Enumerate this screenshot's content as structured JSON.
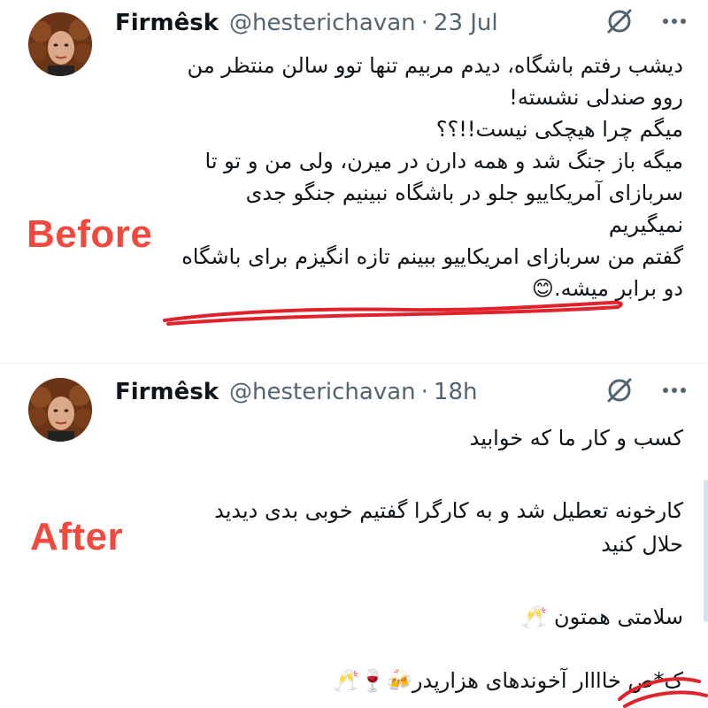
{
  "tweets": [
    {
      "name": "Firmêsk",
      "handle": "@hesterichavan",
      "separator": "·",
      "time": "23 Jul",
      "lines": [
        "دیشب رفتم باشگاه، دیدم مربیم تنها توو سالن منتظر من",
        "روو صندلی نشسته!",
        "میگم چرا هیچکی نیست!!؟؟",
        "میگه باز جنگ شد و همه دارن در میرن، ولی من و تو تا",
        "سربازای آمریکاییو جلو در باشگاه نبینیم جنگو جدی",
        "نمیگیریم",
        "گفتم من سربازای امریکاییو ببینم تازه انگیزم برای باشگاه",
        "دو برابر میشه.😊"
      ]
    },
    {
      "name": "Firmêsk",
      "handle": "@hesterichavan",
      "separator": "·",
      "time": "18h",
      "lines": [
        "کسب و کار ما که خوابید",
        "کارخونه تعطیل شد و به کارگرا گفتیم خوبی بدی دیدید",
        "حلال کنید",
        "سلامتی همتون 🥂",
        "ک*ص خاااار آخوندهای هزارپدر🍻🍷🥂"
      ]
    }
  ],
  "labels": {
    "before": "Before",
    "after": "After"
  },
  "colors": {
    "label_red": "#f2493f",
    "underline_red": "#e0222b",
    "secondary_text": "#536471",
    "thread_bar": "#cfe5f6"
  },
  "icons": {
    "grok": "grok-icon",
    "more": "more-icon"
  }
}
